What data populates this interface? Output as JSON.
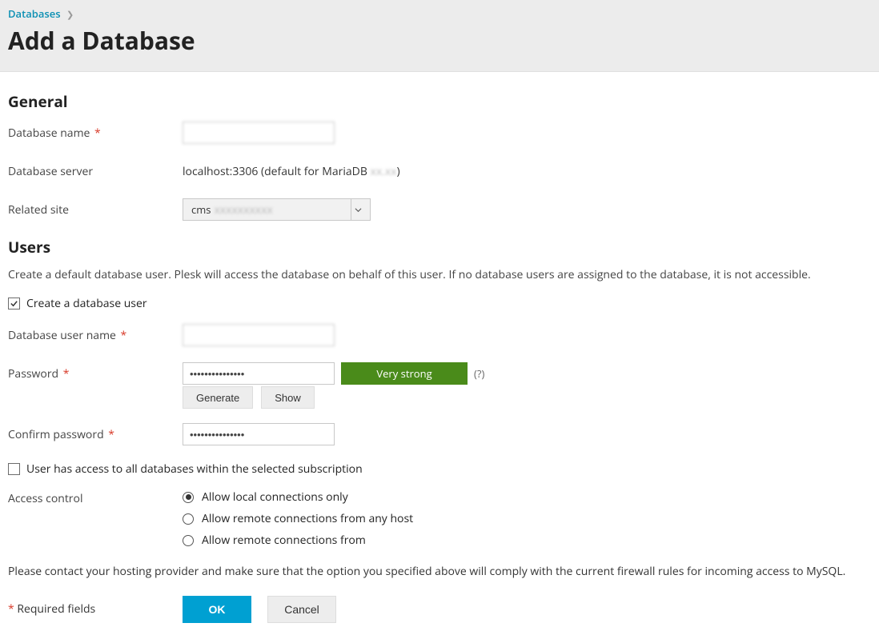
{
  "breadcrumb": {
    "link": "Databases"
  },
  "page_title": "Add a Database",
  "general": {
    "heading": "General",
    "db_name_label": "Database name",
    "db_name_value": "",
    "db_server_label": "Database server",
    "db_server_value_prefix": "localhost:3306 (default for MariaDB",
    "db_server_value_suffix": ")",
    "related_site_label": "Related site",
    "related_site_value": "cms"
  },
  "users": {
    "heading": "Users",
    "help": "Create a default database user. Plesk will access the database on behalf of this user. If no database users are assigned to the database, it is not accessible.",
    "create_user_checkbox": "Create a database user",
    "create_user_checked": true,
    "user_name_label": "Database user name",
    "user_name_value": "",
    "password_label": "Password",
    "password_value": "•••••••••••••••",
    "strength": "Very strong",
    "help_icon": "(?)",
    "generate_btn": "Generate",
    "show_btn": "Show",
    "confirm_label": "Confirm password",
    "confirm_value": "•••••••••••••••",
    "all_db_checkbox": "User has access to all databases within the selected subscription",
    "all_db_checked": false,
    "access_label": "Access control",
    "access_options": [
      "Allow local connections only",
      "Allow remote connections from any host",
      "Allow remote connections from"
    ],
    "access_selected": 0,
    "firewall_note": "Please contact your hosting provider and make sure that the option you specified above will comply with the current firewall rules for incoming access to MySQL."
  },
  "footer": {
    "required": "Required fields",
    "ok": "OK",
    "cancel": "Cancel"
  }
}
